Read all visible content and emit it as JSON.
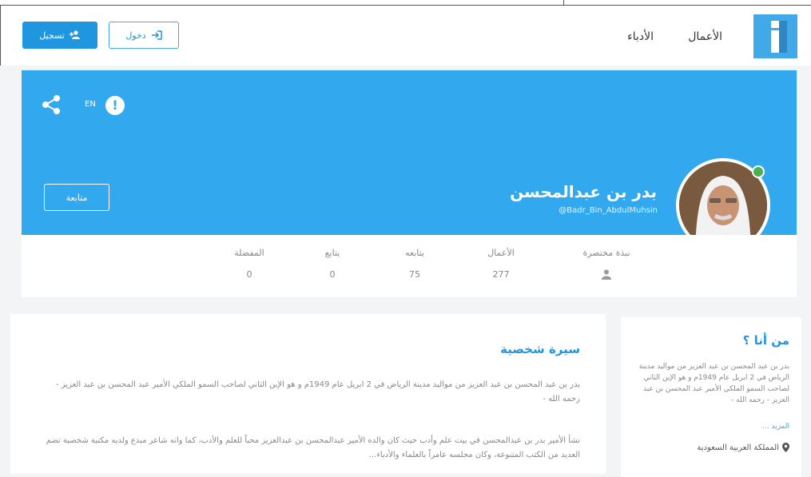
{
  "nav": {
    "works": "الأعمال",
    "writers": "الأدباء",
    "login": "دخول",
    "register": "تسجيل"
  },
  "profile": {
    "name": "بدر بن عبدالمحسن",
    "handle": "@Badr_Bin_AbdulMuhsin",
    "lang": "EN",
    "follow": "متابعة",
    "online_color": "#4caf50",
    "accent": "#32a9ee"
  },
  "stats": [
    {
      "label": "نبذة مختصرة",
      "icon": "person-icon"
    },
    {
      "label": "الأعمال",
      "value": "277"
    },
    {
      "label": "يتابعه",
      "value": "75"
    },
    {
      "label": "يتابع",
      "value": "0"
    },
    {
      "label": "المفضلة",
      "value": "0"
    }
  ],
  "bio": {
    "title": "سيرة شخصية",
    "p1": "بدر بن عبد المحسن بن عبد العزيز من مواليد مدينة الرياض في 2 ابريل عام 1949م و هو الإبن الثاني لصاحب السمو الملكي الأمير عبد المحسن بن عبد العزيز - رحمه الله -",
    "p2": "نشأ الأمير بدر بن عبدالمحسن في بيت علم وأدب حيث كان والده الأمير عبدالمحسن بن عبدالعزيز محباً للعلم والأدب، كما وانه شاعر مبدع ولديه مكتبة شخصية تضم العديد من الكتب المتنوعة، وكان مجلسه عامراً بالعلماء والأدباء..."
  },
  "about": {
    "title": "من أنا ؟",
    "text": "بدر بن عبد المحسن بن عبد العزيز من مواليد مدينة الرياض في 2 ابريل عام 1949م و هو الإبن الثاني لصاحب السمو الملكي الأمير عبد المحسن بن عبد العزيز - رحمه الله -",
    "more": "المزيد ...",
    "location": "المملكة العربية السعودية"
  }
}
